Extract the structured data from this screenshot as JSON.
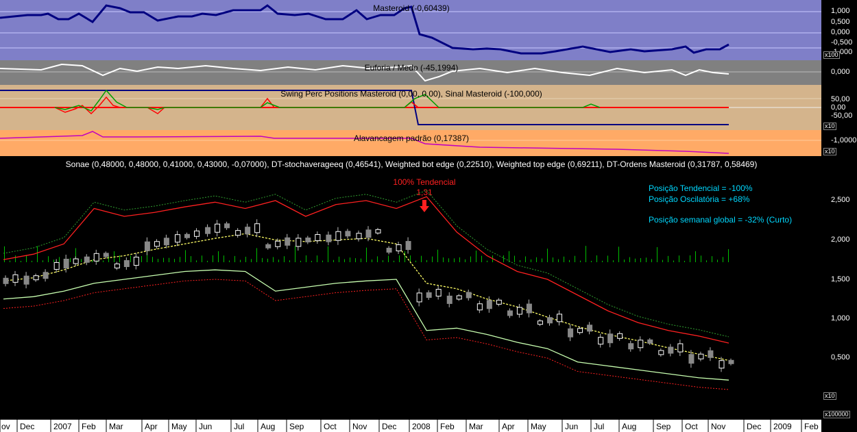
{
  "panels": {
    "masteroid": {
      "title": "Masteroid (-0,60439)",
      "bg": "#7f7fc8",
      "line_color": "#000080",
      "ticks": [
        "1,000",
        "0,500",
        "0,000",
        "-0,500",
        "-1,000"
      ],
      "mult": "x100"
    },
    "euforia": {
      "title": "Euforia / Medo (-45,1994)",
      "bg": "#808080",
      "line_color": "#ffffff",
      "ticks": [
        "0,000"
      ]
    },
    "swing": {
      "title": "Swing Perc Positions Masteroid (0,00, 0,00), Sinal Masteroid (-100,000)",
      "bg": "#d4b48c",
      "ticks": [
        "50,00",
        "0,00",
        "-50,00"
      ],
      "mult": "x10"
    },
    "alavancagem": {
      "title": "Alavancagem padrão (0,17387)",
      "bg": "#ffaa66",
      "ticks": [
        "-1,0000"
      ],
      "mult": "x10"
    }
  },
  "main": {
    "title": "Sonae (0,48000, 0,48000, 0,41000, 0,43000, -0,07000), DT-stochaverageeq (0,46541), Weighted bot edge (0,22510), Weighted top edge (0,69211), DT-Ordens Masteroid (0,31787, 0,58469)",
    "annotation": {
      "label": "100% Tendencial",
      "value": "1,31"
    },
    "info": [
      "Posição Tendencial = -100%",
      "Posição Oscilatória = +68%",
      "Posição semanal global = -32% (Curto)"
    ],
    "ticks": [
      "2,500",
      "2,000",
      "1,500",
      "1,000",
      "0,500"
    ],
    "vol_mult": "x10",
    "axis_mult": "x100000"
  },
  "x_axis": [
    "ov",
    "Dec",
    "2007",
    "Feb",
    "Mar",
    "Apr",
    "May",
    "Jun",
    "Jul",
    "Aug",
    "Sep",
    "Oct",
    "Nov",
    "Dec",
    "2008",
    "Feb",
    "Mar",
    "Apr",
    "May",
    "Jun",
    "Jul",
    "Aug",
    "Sep",
    "Oct",
    "Nov",
    "Dec",
    "2009",
    "Feb"
  ],
  "chart_data": {
    "type": "candlestick",
    "title": "Sonae (0,48000, 0,48000, 0,41000, 0,43000, -0,07000)",
    "x": [
      "Nov 2006",
      "Dec 2006",
      "Jan 2007",
      "Feb 2007",
      "Mar 2007",
      "Apr 2007",
      "May 2007",
      "Jun 2007",
      "Jul 2007",
      "Aug 2007",
      "Sep 2007",
      "Oct 2007",
      "Nov 2007",
      "Dec 2007",
      "Jan 2008",
      "Feb 2008",
      "Mar 2008",
      "Apr 2008",
      "May 2008",
      "Jun 2008",
      "Jul 2008",
      "Aug 2008",
      "Sep 2008",
      "Oct 2008",
      "Nov 2008"
    ],
    "ylim": [
      0,
      2.7
    ],
    "series": [
      {
        "name": "Sonae",
        "values": [
          1.48,
          1.52,
          1.7,
          1.78,
          1.7,
          1.95,
          2.05,
          2.15,
          2.12,
          1.95,
          2.0,
          2.05,
          2.08,
          1.9,
          1.3,
          1.27,
          1.18,
          1.1,
          0.98,
          0.85,
          0.75,
          0.68,
          0.6,
          0.52,
          0.45
        ]
      },
      {
        "name": "Weighted top edge",
        "values": [
          1.75,
          1.82,
          1.95,
          2.4,
          2.3,
          2.35,
          2.42,
          2.48,
          2.4,
          2.5,
          2.3,
          2.45,
          2.5,
          2.4,
          2.55,
          2.1,
          1.8,
          1.6,
          1.5,
          1.3,
          1.1,
          0.95,
          0.85,
          0.78,
          0.69
        ]
      },
      {
        "name": "Weighted bot edge",
        "values": [
          1.25,
          1.28,
          1.35,
          1.45,
          1.5,
          1.55,
          1.6,
          1.62,
          1.6,
          1.35,
          1.4,
          1.45,
          1.48,
          1.5,
          0.85,
          0.88,
          0.8,
          0.7,
          0.62,
          0.45,
          0.4,
          0.35,
          0.3,
          0.25,
          0.22
        ]
      },
      {
        "name": "DT-stochaverageeq",
        "values": [
          1.48,
          1.52,
          1.62,
          1.75,
          1.8,
          1.88,
          1.95,
          2.02,
          2.08,
          2.0,
          1.98,
          2.0,
          2.02,
          1.95,
          1.45,
          1.38,
          1.25,
          1.15,
          1.02,
          0.9,
          0.8,
          0.72,
          0.63,
          0.55,
          0.47
        ]
      }
    ]
  }
}
